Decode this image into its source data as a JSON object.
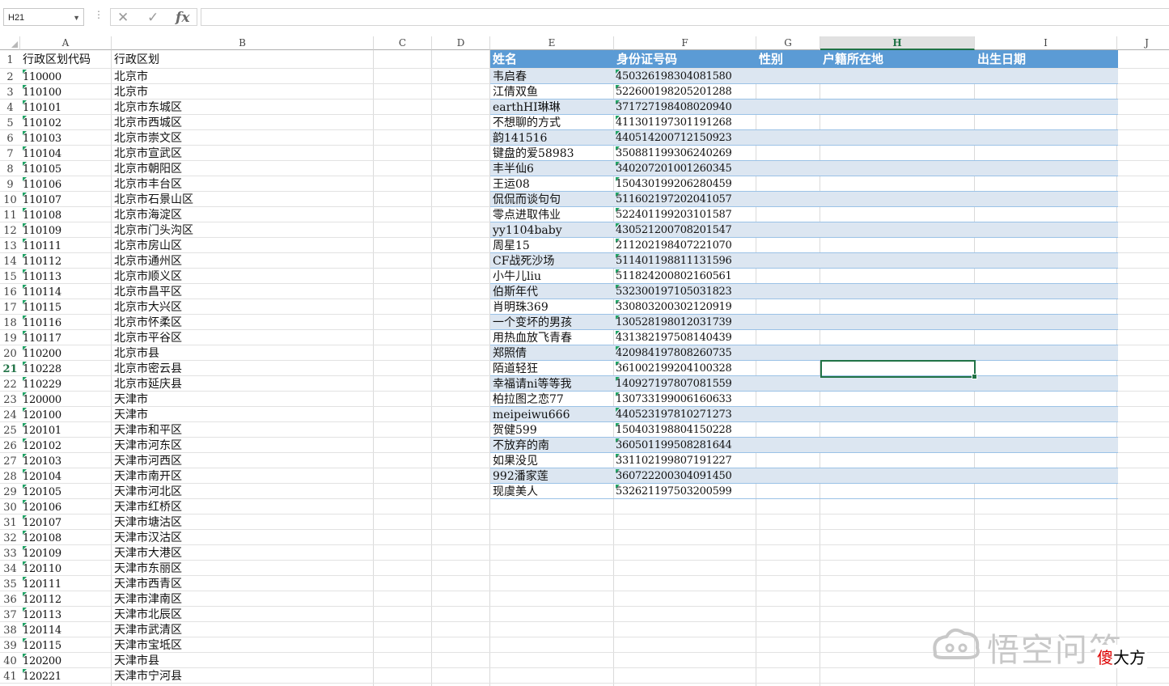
{
  "formula_bar": {
    "name_box": "H21",
    "cancel_icon": "✕",
    "enter_icon": "✓",
    "fx_label": "fx",
    "formula": ""
  },
  "columns": [
    {
      "letter": "A"
    },
    {
      "letter": "B"
    },
    {
      "letter": "C"
    },
    {
      "letter": "D"
    },
    {
      "letter": "E"
    },
    {
      "letter": "F"
    },
    {
      "letter": "G"
    },
    {
      "letter": "H"
    },
    {
      "letter": "I"
    },
    {
      "letter": "J"
    }
  ],
  "selected_cell": "H21",
  "colors": {
    "accent": "#217346",
    "table_header": "#5b9bd5",
    "table_band": "#dce6f1"
  },
  "rows": [
    {
      "n": "1",
      "a": "行政区划代码",
      "b": "行政区划"
    },
    {
      "n": "2",
      "a": "110000",
      "b": "北京市"
    },
    {
      "n": "3",
      "a": "110100",
      "b": "北京市"
    },
    {
      "n": "4",
      "a": "110101",
      "b": "北京市东城区"
    },
    {
      "n": "5",
      "a": "110102",
      "b": "北京市西城区"
    },
    {
      "n": "6",
      "a": "110103",
      "b": "北京市崇文区"
    },
    {
      "n": "7",
      "a": "110104",
      "b": "北京市宣武区"
    },
    {
      "n": "8",
      "a": "110105",
      "b": "北京市朝阳区"
    },
    {
      "n": "9",
      "a": "110106",
      "b": "北京市丰台区"
    },
    {
      "n": "10",
      "a": "110107",
      "b": "北京市石景山区"
    },
    {
      "n": "11",
      "a": "110108",
      "b": "北京市海淀区"
    },
    {
      "n": "12",
      "a": "110109",
      "b": "北京市门头沟区"
    },
    {
      "n": "13",
      "a": "110111",
      "b": "北京市房山区"
    },
    {
      "n": "14",
      "a": "110112",
      "b": "北京市通州区"
    },
    {
      "n": "15",
      "a": "110113",
      "b": "北京市顺义区"
    },
    {
      "n": "16",
      "a": "110114",
      "b": "北京市昌平区"
    },
    {
      "n": "17",
      "a": "110115",
      "b": "北京市大兴区"
    },
    {
      "n": "18",
      "a": "110116",
      "b": "北京市怀柔区"
    },
    {
      "n": "19",
      "a": "110117",
      "b": "北京市平谷区"
    },
    {
      "n": "20",
      "a": "110200",
      "b": "北京市县"
    },
    {
      "n": "21",
      "a": "110228",
      "b": "北京市密云县"
    },
    {
      "n": "22",
      "a": "110229",
      "b": "北京市延庆县"
    },
    {
      "n": "23",
      "a": "120000",
      "b": "天津市"
    },
    {
      "n": "24",
      "a": "120100",
      "b": "天津市"
    },
    {
      "n": "25",
      "a": "120101",
      "b": "天津市和平区"
    },
    {
      "n": "26",
      "a": "120102",
      "b": "天津市河东区"
    },
    {
      "n": "27",
      "a": "120103",
      "b": "天津市河西区"
    },
    {
      "n": "28",
      "a": "120104",
      "b": "天津市南开区"
    },
    {
      "n": "29",
      "a": "120105",
      "b": "天津市河北区"
    },
    {
      "n": "30",
      "a": "120106",
      "b": "天津市红桥区"
    },
    {
      "n": "31",
      "a": "120107",
      "b": "天津市塘沽区"
    },
    {
      "n": "32",
      "a": "120108",
      "b": "天津市汉沽区"
    },
    {
      "n": "33",
      "a": "120109",
      "b": "天津市大港区"
    },
    {
      "n": "34",
      "a": "120110",
      "b": "天津市东丽区"
    },
    {
      "n": "35",
      "a": "120111",
      "b": "天津市西青区"
    },
    {
      "n": "36",
      "a": "120112",
      "b": "天津市津南区"
    },
    {
      "n": "37",
      "a": "120113",
      "b": "天津市北辰区"
    },
    {
      "n": "38",
      "a": "120114",
      "b": "天津市武清区"
    },
    {
      "n": "39",
      "a": "120115",
      "b": "天津市宝坻区"
    },
    {
      "n": "40",
      "a": "120200",
      "b": "天津市县"
    },
    {
      "n": "41",
      "a": "120221",
      "b": "天津市宁河县"
    }
  ],
  "table": {
    "headers": [
      "姓名",
      "身份证号码",
      "性别",
      "户籍所在地",
      "出生日期"
    ],
    "rows": [
      {
        "name": "韦启春",
        "id": "450326198304081580"
      },
      {
        "name": "江倩双鱼",
        "id": "522600198205201288"
      },
      {
        "name": "earthHI琳琳",
        "id": "371727198408020940"
      },
      {
        "name": "不想聊的方式",
        "id": "411301197301191268"
      },
      {
        "name": "韵141516",
        "id": "440514200712150923"
      },
      {
        "name": "键盘的爱58983",
        "id": "350881199306240269"
      },
      {
        "name": "丰半仙6",
        "id": "340207201001260345"
      },
      {
        "name": "王运08",
        "id": "150430199206280459"
      },
      {
        "name": "侃侃而谈句句",
        "id": "511602197202041057"
      },
      {
        "name": "零点进取伟业",
        "id": "522401199203101587"
      },
      {
        "name": "yy1104baby",
        "id": "430521200708201547"
      },
      {
        "name": "周星15",
        "id": "211202198407221070"
      },
      {
        "name": "CF战死沙场",
        "id": "511401198811131596"
      },
      {
        "name": "小牛儿liu",
        "id": "511824200802160561"
      },
      {
        "name": "伯斯年代",
        "id": "532300197105031823"
      },
      {
        "name": "肖明珠369",
        "id": "330803200302120919"
      },
      {
        "name": "一个变坏的男孩",
        "id": "130528198012031739"
      },
      {
        "name": "用热血放飞青春",
        "id": "431382197508140439"
      },
      {
        "name": "郑照倩",
        "id": "420984197808260735"
      },
      {
        "name": "陌道轻狂",
        "id": "361002199204100328"
      },
      {
        "name": "幸福请ni等等我",
        "id": "140927197807081559"
      },
      {
        "name": "柏拉图之恋77",
        "id": "130733199006160633"
      },
      {
        "name": "meipeiwu666",
        "id": "440523197810271273"
      },
      {
        "name": "贺健599",
        "id": "150403198804150228"
      },
      {
        "name": "不放弃的南",
        "id": "360501199508281644"
      },
      {
        "name": "如果没见",
        "id": "331102199807191227"
      },
      {
        "name": "992潘家莲",
        "id": "360722200304091450"
      },
      {
        "name": "现虞美人",
        "id": "532621197503200599"
      }
    ]
  },
  "watermark": {
    "text": "悟空问答",
    "tag_prefix": "傻",
    "tag_rest": "大方"
  }
}
